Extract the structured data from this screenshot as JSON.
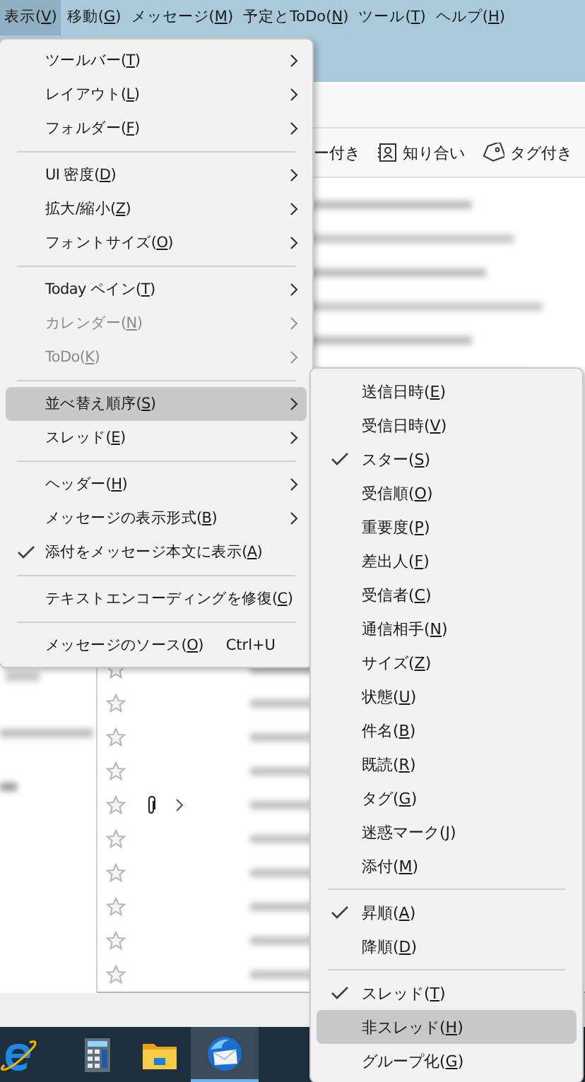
{
  "menubar": [
    {
      "label": "表示(V)",
      "selected": true
    },
    {
      "label": "移動(G)",
      "selected": false
    },
    {
      "label": "メッセージ(M)",
      "selected": false
    },
    {
      "label": "予定とToDo(N)",
      "selected": false
    },
    {
      "label": "ツール(T)",
      "selected": false
    },
    {
      "label": "ヘルプ(H)",
      "selected": false
    }
  ],
  "toolbar": [
    {
      "label": "ー付き",
      "kind": "plain"
    },
    {
      "label": "知り合い",
      "kind": "contact"
    },
    {
      "label": "タグ付き",
      "kind": "tag"
    }
  ],
  "message_list": {
    "rows": [
      {
        "starred": false,
        "attachment": false,
        "thread": false
      },
      {
        "starred": false,
        "attachment": false,
        "thread": false
      },
      {
        "starred": false,
        "attachment": false,
        "thread": false
      },
      {
        "starred": false,
        "attachment": false,
        "thread": false
      },
      {
        "starred": false,
        "attachment": true,
        "thread": true
      },
      {
        "starred": false,
        "attachment": false,
        "thread": false
      },
      {
        "starred": false,
        "attachment": false,
        "thread": false
      },
      {
        "starred": false,
        "attachment": false,
        "thread": false
      },
      {
        "starred": false,
        "attachment": false,
        "thread": false
      },
      {
        "starred": false,
        "attachment": false,
        "thread": false
      }
    ]
  },
  "view_menu": {
    "items": [
      {
        "kind": "item",
        "label": "ツールバー(T)",
        "submenu": true,
        "checked": false,
        "disabled": false,
        "selected": false
      },
      {
        "kind": "item",
        "label": "レイアウト(L)",
        "submenu": true,
        "checked": false,
        "disabled": false,
        "selected": false
      },
      {
        "kind": "item",
        "label": "フォルダー(F)",
        "submenu": true,
        "checked": false,
        "disabled": false,
        "selected": false
      },
      {
        "kind": "separator"
      },
      {
        "kind": "item",
        "label": "UI 密度(D)",
        "submenu": true,
        "checked": false,
        "disabled": false,
        "selected": false
      },
      {
        "kind": "item",
        "label": "拡大/縮小(Z)",
        "submenu": true,
        "checked": false,
        "disabled": false,
        "selected": false
      },
      {
        "kind": "item",
        "label": "フォントサイズ(O)",
        "submenu": true,
        "checked": false,
        "disabled": false,
        "selected": false
      },
      {
        "kind": "separator"
      },
      {
        "kind": "item",
        "label": "Today ペイン(T)",
        "submenu": true,
        "checked": false,
        "disabled": false,
        "selected": false
      },
      {
        "kind": "item",
        "label": "カレンダー(N)",
        "submenu": true,
        "checked": false,
        "disabled": true,
        "selected": false
      },
      {
        "kind": "item",
        "label": "ToDo(K)",
        "submenu": true,
        "checked": false,
        "disabled": true,
        "selected": false
      },
      {
        "kind": "separator"
      },
      {
        "kind": "item",
        "label": "並べ替え順序(S)",
        "submenu": true,
        "checked": false,
        "disabled": false,
        "selected": true
      },
      {
        "kind": "item",
        "label": "スレッド(E)",
        "submenu": true,
        "checked": false,
        "disabled": false,
        "selected": false
      },
      {
        "kind": "separator"
      },
      {
        "kind": "item",
        "label": "ヘッダー(H)",
        "submenu": true,
        "checked": false,
        "disabled": false,
        "selected": false
      },
      {
        "kind": "item",
        "label": "メッセージの表示形式(B)",
        "submenu": true,
        "checked": false,
        "disabled": false,
        "selected": false
      },
      {
        "kind": "item",
        "label": "添付をメッセージ本文に表示(A)",
        "submenu": false,
        "checked": true,
        "disabled": false,
        "selected": false
      },
      {
        "kind": "separator"
      },
      {
        "kind": "item",
        "label": "テキストエンコーディングを修復(C)",
        "submenu": false,
        "checked": false,
        "disabled": false,
        "selected": false
      },
      {
        "kind": "separator"
      },
      {
        "kind": "item",
        "label": "メッセージのソース(O)",
        "shortcut": "Ctrl+U",
        "submenu": false,
        "checked": false,
        "disabled": false,
        "selected": false
      }
    ]
  },
  "sort_submenu": {
    "items": [
      {
        "kind": "item",
        "label": "送信日時(E)",
        "checked": false,
        "selected": false
      },
      {
        "kind": "item",
        "label": "受信日時(V)",
        "checked": false,
        "selected": false
      },
      {
        "kind": "item",
        "label": "スター(S)",
        "checked": true,
        "selected": false
      },
      {
        "kind": "item",
        "label": "受信順(O)",
        "checked": false,
        "selected": false
      },
      {
        "kind": "item",
        "label": "重要度(P)",
        "checked": false,
        "selected": false
      },
      {
        "kind": "item",
        "label": "差出人(F)",
        "checked": false,
        "selected": false
      },
      {
        "kind": "item",
        "label": "受信者(C)",
        "checked": false,
        "selected": false
      },
      {
        "kind": "item",
        "label": "通信相手(N)",
        "checked": false,
        "selected": false
      },
      {
        "kind": "item",
        "label": "サイズ(Z)",
        "checked": false,
        "selected": false
      },
      {
        "kind": "item",
        "label": "状態(U)",
        "checked": false,
        "selected": false
      },
      {
        "kind": "item",
        "label": "件名(B)",
        "checked": false,
        "selected": false
      },
      {
        "kind": "item",
        "label": "既読(R)",
        "checked": false,
        "selected": false
      },
      {
        "kind": "item",
        "label": "タグ(G)",
        "checked": false,
        "selected": false
      },
      {
        "kind": "item",
        "label": "迷惑マーク(J)",
        "checked": false,
        "selected": false
      },
      {
        "kind": "item",
        "label": "添付(M)",
        "checked": false,
        "selected": false
      },
      {
        "kind": "separator"
      },
      {
        "kind": "item",
        "label": "昇順(A)",
        "checked": true,
        "selected": false
      },
      {
        "kind": "item",
        "label": "降順(D)",
        "checked": false,
        "selected": false
      },
      {
        "kind": "separator"
      },
      {
        "kind": "item",
        "label": "スレッド(T)",
        "checked": true,
        "selected": false
      },
      {
        "kind": "item",
        "label": "非スレッド(H)",
        "checked": false,
        "selected": true
      },
      {
        "kind": "item",
        "label": "グループ化(G)",
        "checked": false,
        "selected": false
      }
    ]
  },
  "taskbar": [
    {
      "kind": "browser",
      "active": false
    },
    {
      "kind": "calculator",
      "active": false
    },
    {
      "kind": "explorer",
      "active": false
    },
    {
      "kind": "mail",
      "active": true
    }
  ]
}
